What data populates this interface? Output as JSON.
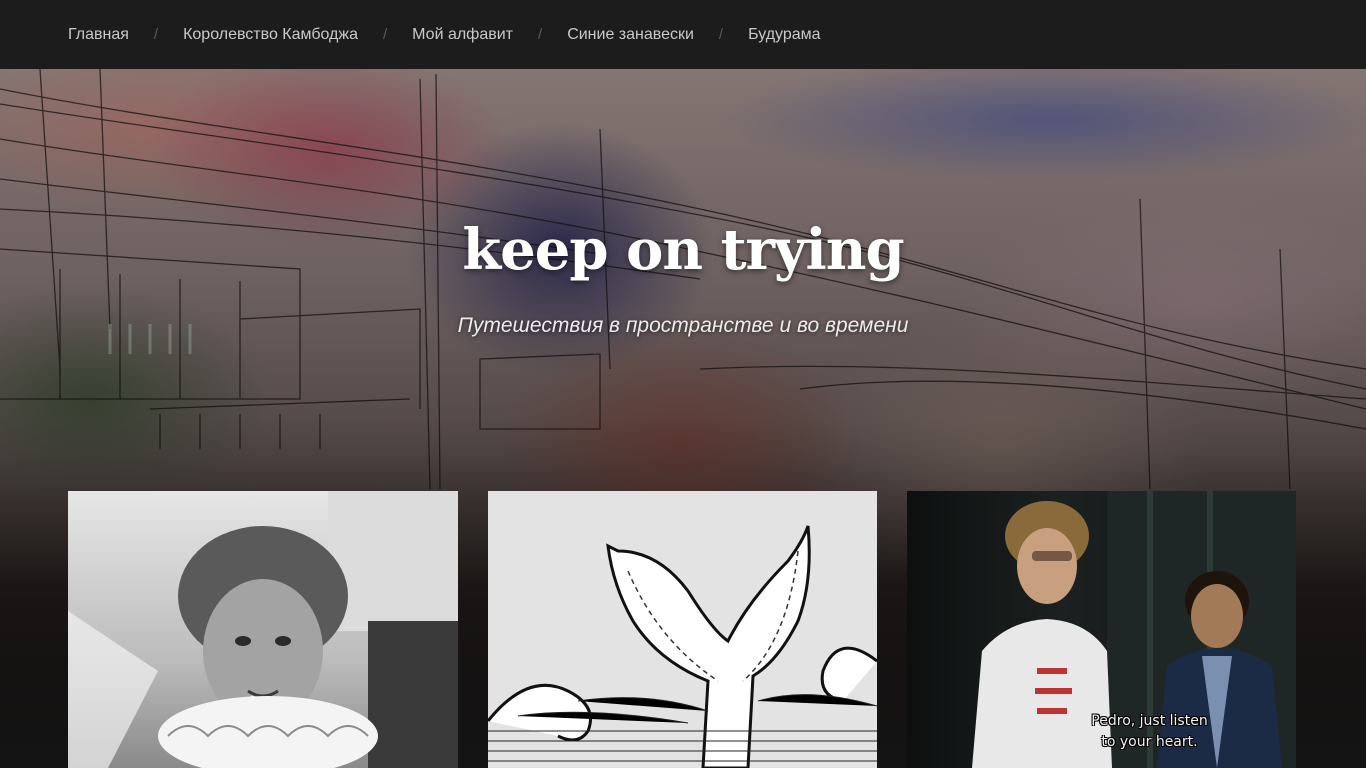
{
  "nav": {
    "items": [
      {
        "label": "Главная"
      },
      {
        "label": "Королевство Камбоджа"
      },
      {
        "label": "Мой алфавит"
      },
      {
        "label": "Синие занавески"
      },
      {
        "label": "Будурама"
      }
    ],
    "separator": "/"
  },
  "header": {
    "title": "keep on trying",
    "description": "Путешествия в пространстве и во времени"
  },
  "posts": [
    {
      "image": "portrait-photo"
    },
    {
      "image": "whale-tail-illustration"
    },
    {
      "image": "movie-still",
      "subtitle_line1": "Pedro, just listen",
      "subtitle_line2": "to your heart."
    }
  ]
}
